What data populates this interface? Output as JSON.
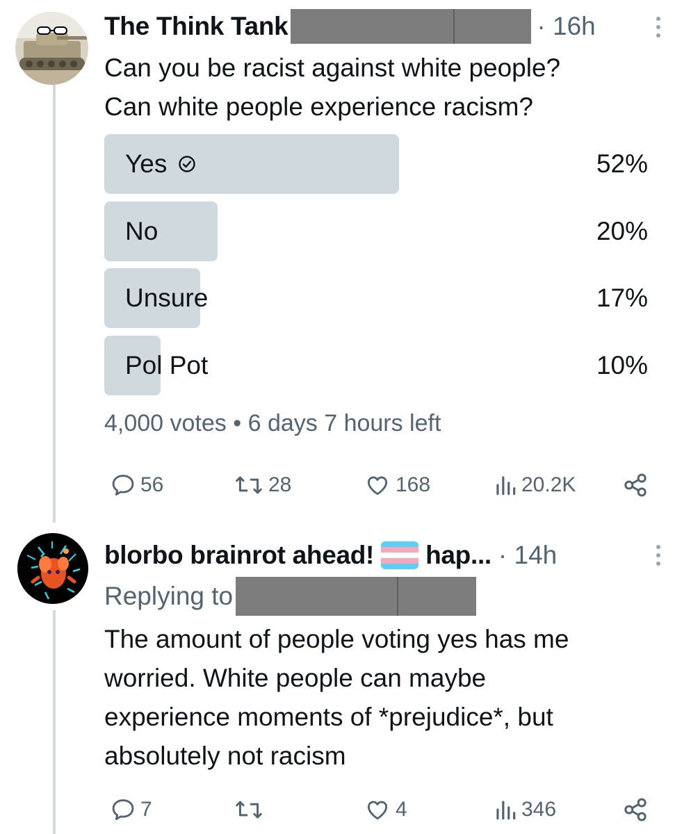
{
  "tweet1": {
    "author": "The Think Tank",
    "time": "· 16h",
    "text_line1": "Can you be racist against white people?",
    "text_line2": "Can white people experience racism?",
    "poll": {
      "options": [
        {
          "label": "Yes",
          "percent": "52%",
          "value": 52,
          "winner": true
        },
        {
          "label": "No",
          "percent": "20%",
          "value": 20,
          "winner": false
        },
        {
          "label": "Unsure",
          "percent": "17%",
          "value": 17,
          "winner": false
        },
        {
          "label": "Pol Pot",
          "percent": "10%",
          "value": 10,
          "winner": false
        }
      ],
      "meta": "4,000 votes • 6 days 7 hours left"
    },
    "stats": {
      "replies": "56",
      "retweets": "28",
      "likes": "168",
      "views": "20.2K"
    }
  },
  "tweet2": {
    "author_part1": "blorbo brainrot ahead!",
    "author_part2": "hap...",
    "time": "· 14h",
    "replying_to": "Replying to",
    "text_lines": [
      "The amount of people voting yes has me",
      "worried. White people can maybe",
      "experience moments of *prejudice*, but",
      "absolutely not racism"
    ],
    "stats": {
      "replies": "7",
      "retweets": "",
      "likes": "4",
      "views": "346"
    }
  },
  "colors": {
    "poll_fill": "#cfd9de",
    "muted": "#536471",
    "text": "#0f1419",
    "redaction": "#7d7d7d"
  },
  "icons": [
    "more-icon",
    "check-circle-icon",
    "reply-icon",
    "retweet-icon",
    "like-icon",
    "views-icon",
    "share-icon",
    "trans-flag-icon"
  ]
}
